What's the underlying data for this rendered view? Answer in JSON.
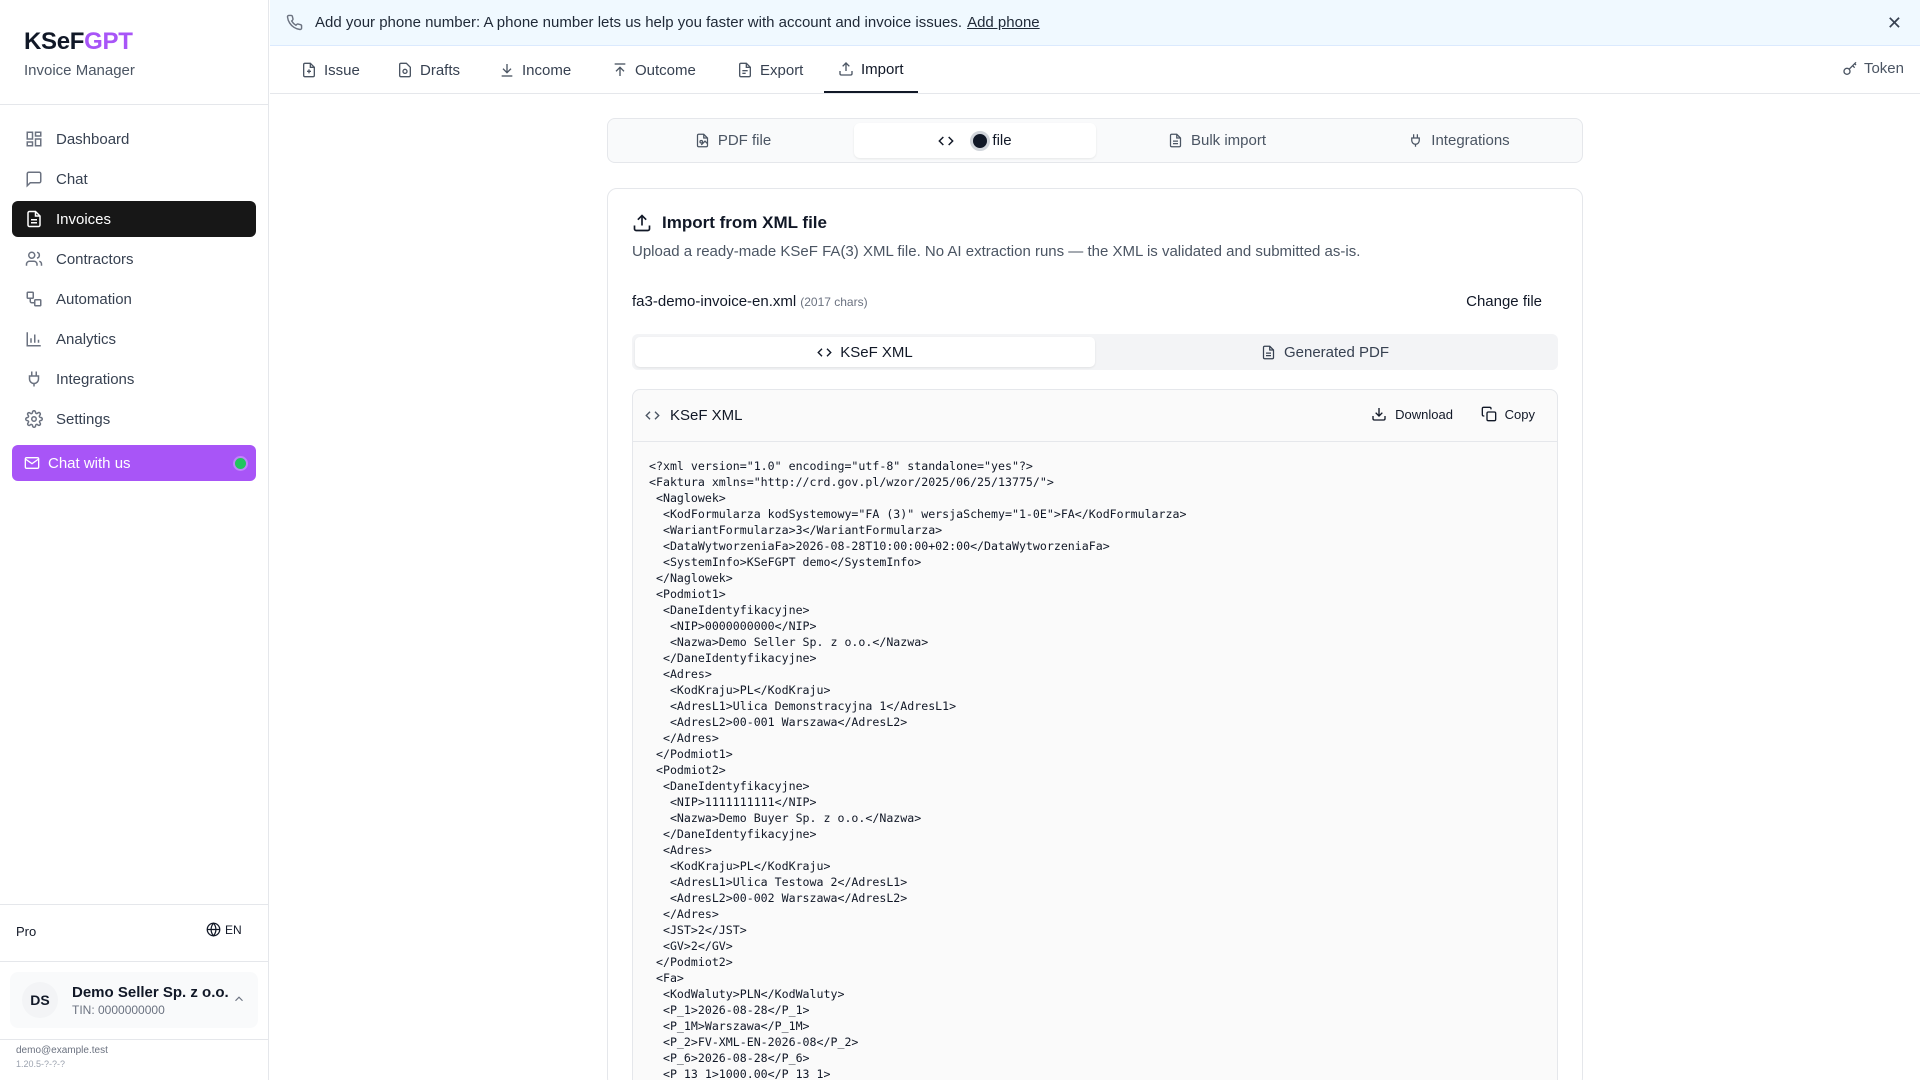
{
  "app": {
    "brand_main": "KSeF",
    "brand_accent": "GPT",
    "subtitle": "Invoice Manager"
  },
  "sidebar": {
    "items": [
      {
        "label": "Dashboard",
        "icon": "dashboard-icon"
      },
      {
        "label": "Chat",
        "icon": "chat-icon"
      },
      {
        "label": "Invoices",
        "icon": "document-icon",
        "active": true
      },
      {
        "label": "Contractors",
        "icon": "users-icon"
      },
      {
        "label": "Automation",
        "icon": "automation-icon"
      },
      {
        "label": "Analytics",
        "icon": "bar-chart-icon"
      },
      {
        "label": "Integrations",
        "icon": "plug-icon"
      },
      {
        "label": "Settings",
        "icon": "gear-icon"
      }
    ],
    "chat_button": "Chat with us",
    "plan": "Pro",
    "language": "EN",
    "account": {
      "initials": "DS",
      "name": "Demo Seller Sp. z o.o.",
      "tin": "TIN: 0000000000"
    },
    "email": "demo@example.test",
    "version": "1.20.5-?-?-?"
  },
  "banner": {
    "text": "Add your phone number: A phone number lets us help you faster with account and invoice issues.",
    "link": "Add phone"
  },
  "top_tabs": {
    "items": [
      {
        "label": "Issue",
        "icon": "file-plus-icon"
      },
      {
        "label": "Drafts",
        "icon": "draft-icon"
      },
      {
        "label": "Income",
        "icon": "download-arrow-icon"
      },
      {
        "label": "Outcome",
        "icon": "upload-arrow-icon"
      },
      {
        "label": "Export",
        "icon": "file-export-icon"
      },
      {
        "label": "Import",
        "icon": "upload-icon",
        "active": true
      }
    ],
    "token": "Token"
  },
  "import_tabs": {
    "items": [
      {
        "label": "PDF file",
        "icon": "pdf-file-icon"
      },
      {
        "label": "file",
        "icon": "code-icon",
        "active": true
      },
      {
        "label": "Bulk import",
        "icon": "file-stack-icon"
      },
      {
        "label": "Integrations",
        "icon": "plug-icon"
      }
    ]
  },
  "card": {
    "title": "Import from XML file",
    "description": "Upload a ready-made KSeF FA(3) XML file. No AI extraction runs — the XML is validated and submitted as-is.",
    "file_name": "fa3-demo-invoice-en.xml",
    "file_chars": "(2017 chars)",
    "change_file": "Change file",
    "view_tabs": {
      "xml": "KSeF XML",
      "pdf": "Generated PDF"
    },
    "panel": {
      "title": "KSeF XML",
      "download": "Download",
      "copy": "Copy"
    },
    "xml_lines": [
      "<?xml version=\"1.0\" encoding=\"utf-8\" standalone=\"yes\"?>",
      "<Faktura xmlns=\"http://crd.gov.pl/wzor/2025/06/25/13775/\">",
      " <Naglowek>",
      "  <KodFormularza kodSystemowy=\"FA (3)\" wersjaSchemy=\"1-0E\">FA</KodFormularza>",
      "  <WariantFormularza>3</WariantFormularza>",
      "  <DataWytworzeniaFa>2026-08-28T10:00:00+02:00</DataWytworzeniaFa>",
      "  <SystemInfo>KSeFGPT demo</SystemInfo>",
      " </Naglowek>",
      " <Podmiot1>",
      "  <DaneIdentyfikacyjne>",
      "   <NIP>0000000000</NIP>",
      "   <Nazwa>Demo Seller Sp. z o.o.</Nazwa>",
      "  </DaneIdentyfikacyjne>",
      "  <Adres>",
      "   <KodKraju>PL</KodKraju>",
      "   <AdresL1>Ulica Demonstracyjna 1</AdresL1>",
      "   <AdresL2>00-001 Warszawa</AdresL2>",
      "  </Adres>",
      " </Podmiot1>",
      " <Podmiot2>",
      "  <DaneIdentyfikacyjne>",
      "   <NIP>1111111111</NIP>",
      "   <Nazwa>Demo Buyer Sp. z o.o.</Nazwa>",
      "  </DaneIdentyfikacyjne>",
      "  <Adres>",
      "   <KodKraju>PL</KodKraju>",
      "   <AdresL1>Ulica Testowa 2</AdresL1>",
      "   <AdresL2>00-002 Warszawa</AdresL2>",
      "  </Adres>",
      "  <JST>2</JST>",
      "  <GV>2</GV>",
      " </Podmiot2>",
      " <Fa>",
      "  <KodWaluty>PLN</KodWaluty>",
      "  <P_1>2026-08-28</P_1>",
      "  <P_1M>Warszawa</P_1M>",
      "  <P_2>FV-XML-EN-2026-08</P_2>",
      "  <P_6>2026-08-28</P_6>",
      "  <P_13_1>1000.00</P_13_1>"
    ]
  },
  "colors": {
    "accent": "#a855f7",
    "active_nav": "#171717",
    "banner_bg": "#f0f9ff",
    "status_dot": "#22c55e"
  }
}
